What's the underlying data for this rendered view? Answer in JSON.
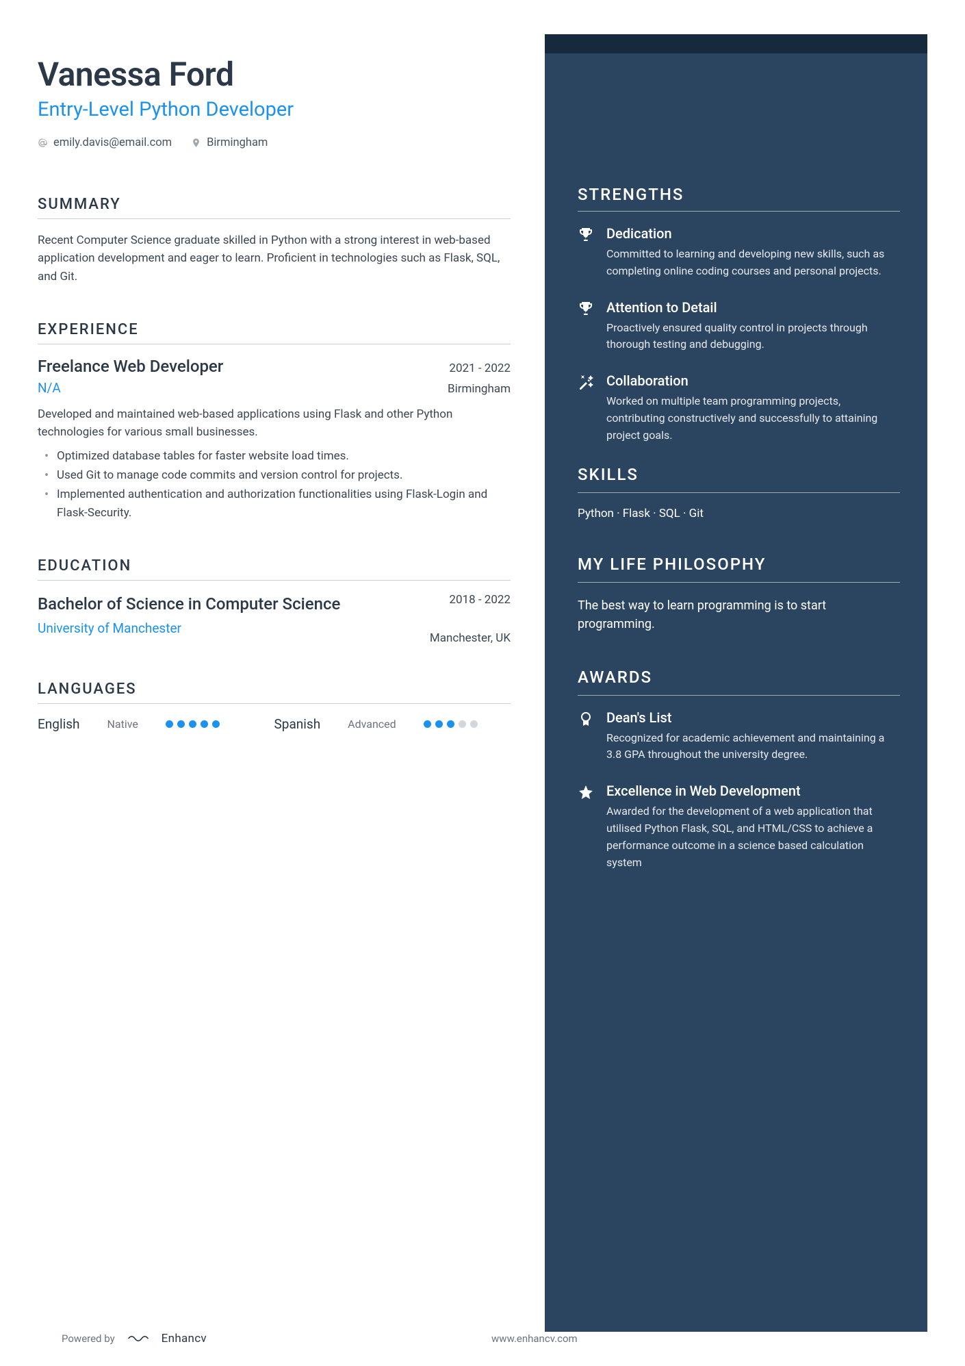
{
  "header": {
    "name": "Vanessa Ford",
    "title": "Entry-Level Python Developer",
    "email": "emily.davis@email.com",
    "location": "Birmingham"
  },
  "sections": {
    "summary_heading": "SUMMARY",
    "experience_heading": "EXPERIENCE",
    "education_heading": "EDUCATION",
    "languages_heading": "LANGUAGES",
    "strengths_heading": "STRENGTHS",
    "skills_heading": "SKILLS",
    "philosophy_heading": "MY LIFE PHILOSOPHY",
    "awards_heading": "AWARDS"
  },
  "summary": "Recent Computer Science graduate skilled in Python with a strong interest in web-based application development and eager to learn. Proficient in technologies such as Flask, SQL, and Git.",
  "experience": {
    "title": "Freelance Web Developer",
    "dates": "2021 - 2022",
    "company": "N/A",
    "location": "Birmingham",
    "desc": "Developed and maintained web-based applications using Flask and other Python technologies for various small businesses.",
    "bullets": [
      "Optimized database tables for faster website load times.",
      "Used Git to manage code commits and version control for projects.",
      "Implemented authentication and authorization functionalities using Flask-Login and Flask-Security."
    ]
  },
  "education": {
    "degree": "Bachelor of Science in Computer Science",
    "dates": "2018 - 2022",
    "school": "University of Manchester",
    "location": "Manchester, UK"
  },
  "languages": [
    {
      "name": "English",
      "level": "Native",
      "score": 5
    },
    {
      "name": "Spanish",
      "level": "Advanced",
      "score": 3
    }
  ],
  "strengths": [
    {
      "title": "Dedication",
      "desc": "Committed to learning and developing new skills, such as completing online coding courses and personal projects.",
      "icon": "trophy"
    },
    {
      "title": "Attention to Detail",
      "desc": "Proactively ensured quality control in projects through thorough testing and debugging.",
      "icon": "trophy"
    },
    {
      "title": "Collaboration",
      "desc": "Worked on multiple team programming projects, contributing constructively and successfully to attaining project goals.",
      "icon": "wand"
    }
  ],
  "skills": "Python · Flask · SQL · Git",
  "philosophy": "The best way to learn programming is to start programming.",
  "awards": [
    {
      "title": "Dean's List",
      "desc": "Recognized for academic achievement and maintaining a 3.8 GPA throughout the university degree.",
      "icon": "medal"
    },
    {
      "title": "Excellence in Web Development",
      "desc": "Awarded for the development of a web application that utilised Python Flask, SQL, and HTML/CSS to achieve a performance outcome in a science based calculation system",
      "icon": "star"
    }
  ],
  "footer": {
    "powered": "Powered by",
    "brand": "Enhancv",
    "url": "www.enhancv.com"
  }
}
